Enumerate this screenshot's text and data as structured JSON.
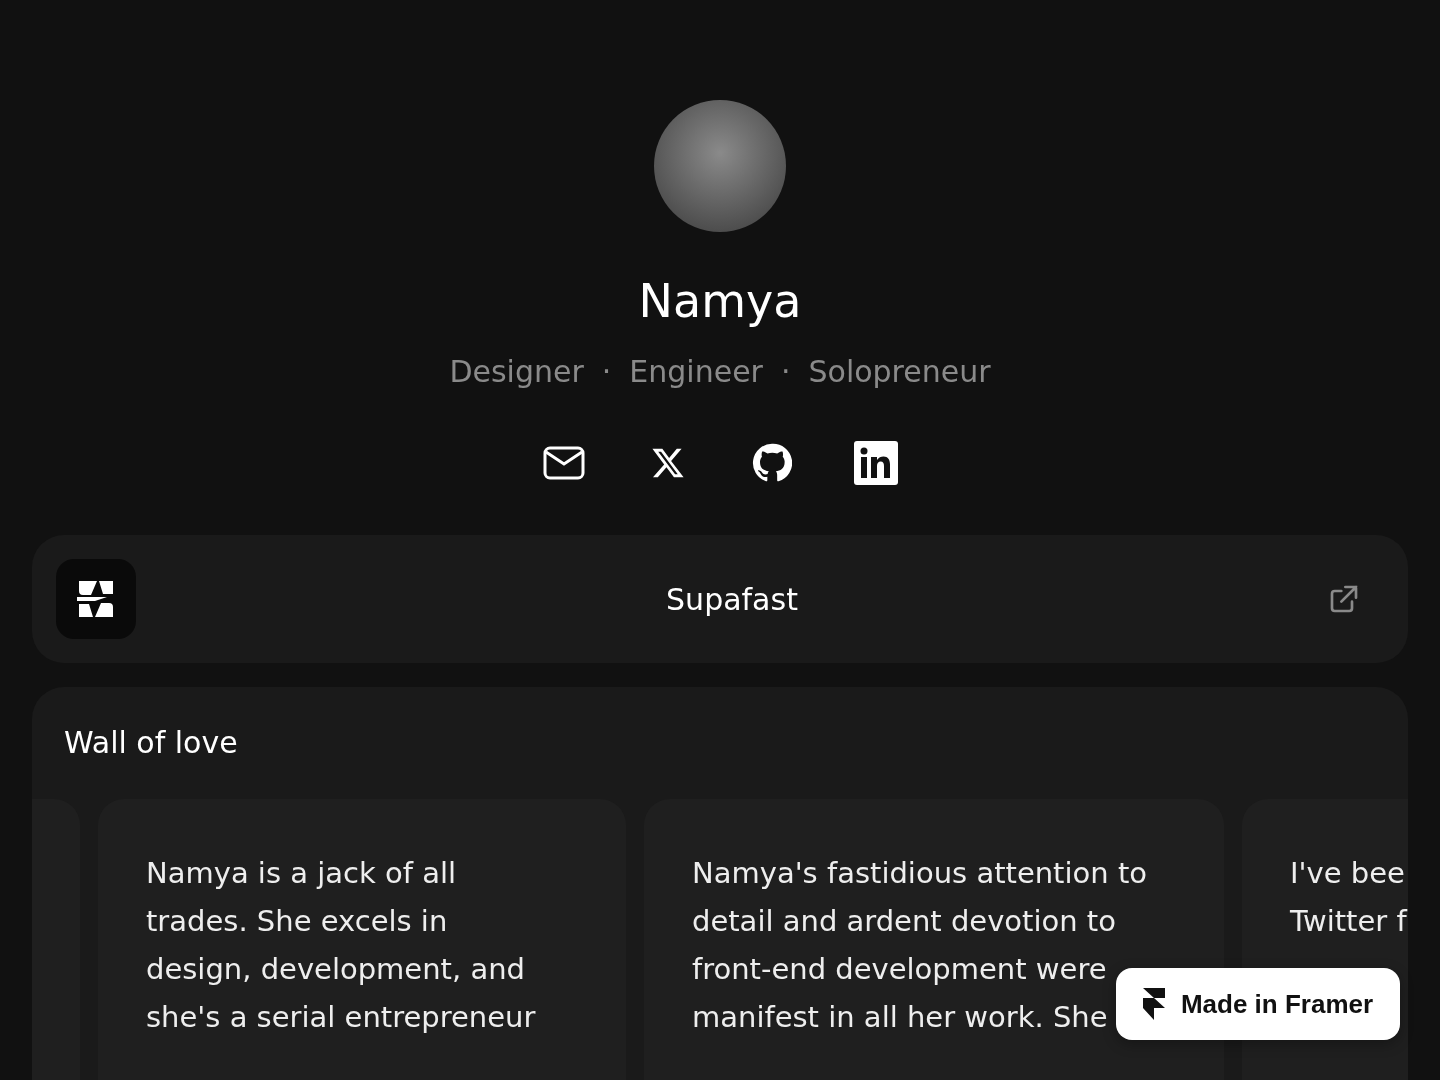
{
  "profile": {
    "name": "Namya",
    "roles": [
      "Designer",
      "Engineer",
      "Solopreneur"
    ],
    "separator": "·"
  },
  "socials": [
    {
      "kind": "email"
    },
    {
      "kind": "x"
    },
    {
      "kind": "github"
    },
    {
      "kind": "linkedin"
    }
  ],
  "project": {
    "title": "Supafast"
  },
  "wall": {
    "title": "Wall of love",
    "testimonials": [
      {
        "lines": [
          "Namya is a jack of all",
          "trades. She excels in",
          "design, development, and",
          "she's a serial entrepreneur"
        ]
      },
      {
        "lines": [
          "Namya's fastidious attention to",
          "detail and ardent devotion to",
          "front-end development were",
          "manifest in all her work. She"
        ]
      },
      {
        "lines": [
          "I've bee",
          "Twitter f"
        ]
      }
    ]
  },
  "badge": {
    "label": "Made in Framer"
  }
}
